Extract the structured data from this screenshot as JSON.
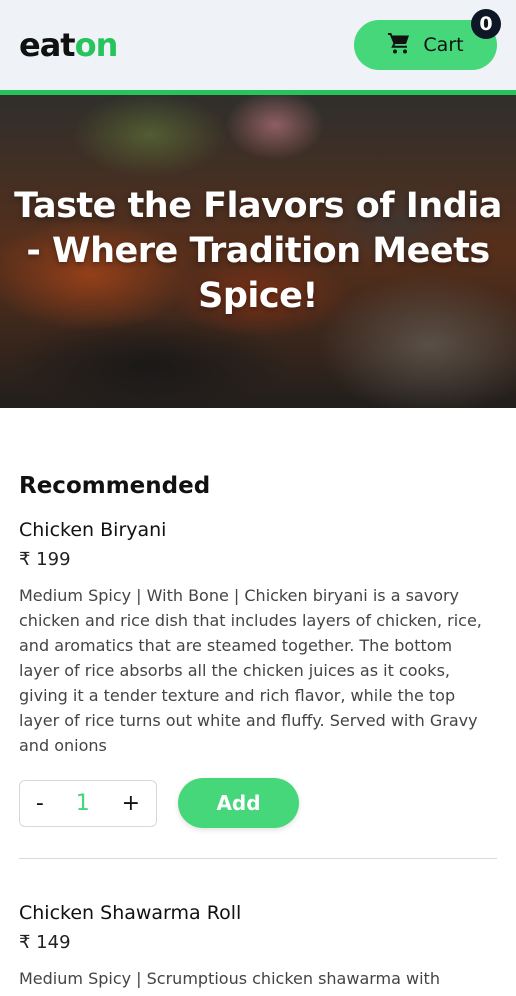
{
  "header": {
    "logo_part1": "eat",
    "logo_part2": "on",
    "cart_label": "Cart",
    "cart_count": "0"
  },
  "hero": {
    "title": "Taste the Flavors of India - Where Tradition Meets Spice!"
  },
  "section": {
    "title": "Recommended"
  },
  "items": [
    {
      "name": "Chicken Biryani",
      "price": "₹ 199",
      "description": "Medium Spicy | With Bone | Chicken biryani is a savory chicken and rice dish that includes layers of chicken, rice, and aromatics that are steamed together. The bottom layer of rice absorbs all the chicken juices as it cooks, giving it a tender texture and rich flavor, while the top layer of rice turns out white and fluffy. Served with Gravy and onions",
      "minus": "-",
      "quantity": "1",
      "plus": "+",
      "add_label": "Add"
    },
    {
      "name": "Chicken Shawarma Roll",
      "price": "₹ 149",
      "description": "Medium Spicy | Scrumptious chicken shawarma with"
    }
  ],
  "colors": {
    "accent": "#45d77a",
    "logo_green": "#27c45c",
    "header_bg": "#eff3f8",
    "badge_bg": "#0e1726"
  },
  "icons": {
    "cart": "cart-icon"
  }
}
